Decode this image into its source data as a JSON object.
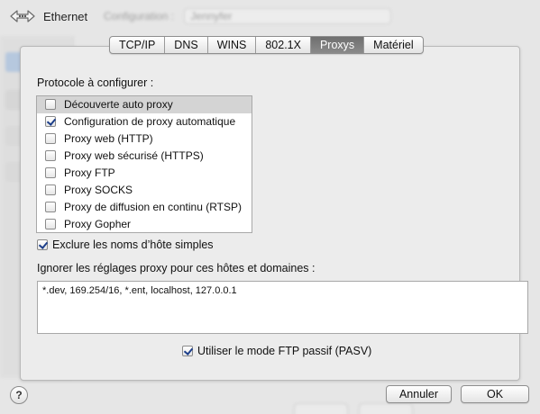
{
  "window": {
    "title": "Ethernet",
    "icon": "ethernet-arrows-icon"
  },
  "background": {
    "configuration_label": "Configuration :",
    "configuration_value": "Jennyfer"
  },
  "tabs": [
    {
      "label": "TCP/IP",
      "active": false
    },
    {
      "label": "DNS",
      "active": false
    },
    {
      "label": "WINS",
      "active": false
    },
    {
      "label": "802.1X",
      "active": false
    },
    {
      "label": "Proxys",
      "active": true
    },
    {
      "label": "Matériel",
      "active": false
    }
  ],
  "protocols": {
    "label": "Protocole à configurer :",
    "items": [
      {
        "label": "Découverte auto proxy",
        "checked": false,
        "selected": true
      },
      {
        "label": "Configuration de proxy automatique",
        "checked": true,
        "selected": false
      },
      {
        "label": "Proxy web (HTTP)",
        "checked": false,
        "selected": false
      },
      {
        "label": "Proxy web sécurisé (HTTPS)",
        "checked": false,
        "selected": false
      },
      {
        "label": "Proxy FTP",
        "checked": false,
        "selected": false
      },
      {
        "label": "Proxy SOCKS",
        "checked": false,
        "selected": false
      },
      {
        "label": "Proxy de diffusion en continu (RTSP)",
        "checked": false,
        "selected": false
      },
      {
        "label": "Proxy Gopher",
        "checked": false,
        "selected": false
      }
    ]
  },
  "exclude_simple": {
    "label": "Exclure les noms d’hôte simples",
    "checked": true
  },
  "ignore": {
    "label": "Ignorer les réglages proxy pour ces hôtes et domaines :",
    "value": "*.dev, 169.254/16, *.ent, localhost, 127.0.0.1"
  },
  "pasv": {
    "label": "Utiliser le mode FTP passif (PASV)",
    "checked": true
  },
  "buttons": {
    "help": "?",
    "cancel": "Annuler",
    "ok": "OK"
  },
  "colors": {
    "active_tab": "#7a7a7a",
    "checkmark": "#1c3e8a",
    "selection": "#d4d4d4"
  }
}
